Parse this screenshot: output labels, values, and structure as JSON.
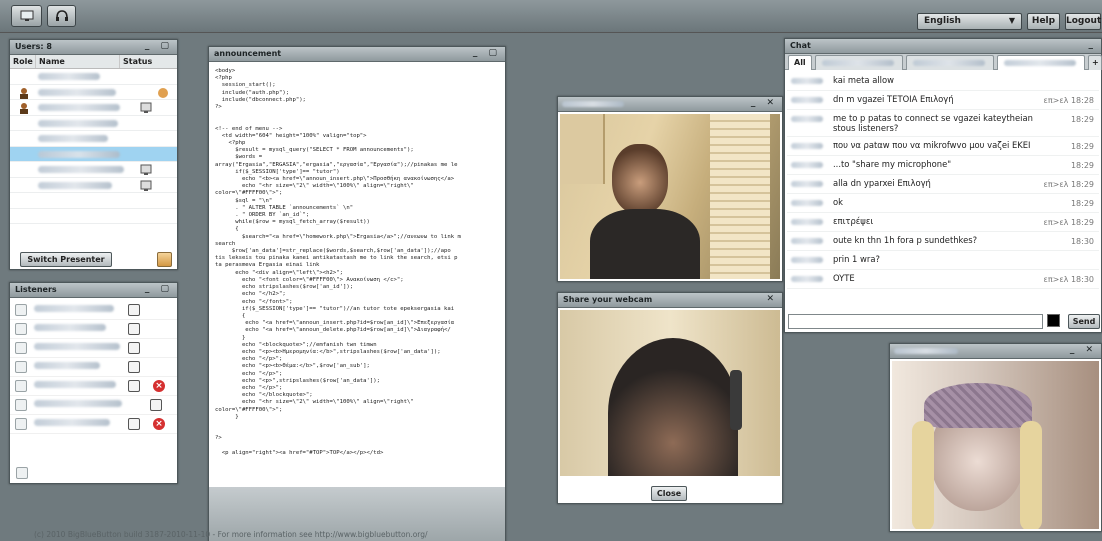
{
  "topbar": {
    "language": "English",
    "help": "Help",
    "logout": "Logout"
  },
  "users": {
    "title": "Users: 8",
    "col_role": "Role",
    "col_name": "Name",
    "col_status": "Status",
    "switch_presenter": "Switch Presenter"
  },
  "listeners": {
    "title": "Listeners"
  },
  "announcement": {
    "title": "announcement",
    "code": "<body>\n<?php\n  session_start();\n  include(\"auth.php\");\n  include(\"dbconnect.php\");\n?>\n\n\n<!-- end of menu -->\n  <td width=\"604\" height=\"100%\" valign=\"top\">\n    <?php\n      $result = mysql_query(\"SELECT * FROM announcements\");\n      $words =\narray(\"Ergasia\",\"ERGASIA\",\"ergasia\",\"εργασία\",\"Εργασία\");//pinakas me le\n      if($_SESSION['type']== \"tutor\")\n        echo \"<b><a href=\\\"announ_insert.php\\\">Προσθήκη ανακοίνωσης</a>\n        echo \"<hr size=\\\"2\\\" width=\\\"100%\\\" align=\\\"right\\\"\ncolor=\\\"#FFFF00\\\">\";\n      $sql = \"\\n\"\n      . \" ALTER TABLE `announcements` \\n\"\n      . \" ORDER BY `an_id`\";\n      while($row = mysql_fetch_array($result))\n      {\n        $search=\"<a href=\\\"homework.php\\\">Ergasia</a>\";//ανεωνω to link m\nsearch\n     $row['an_data']=str_replace($words,$search,$row['an_data']);//apo\ntis lekseis tou pinaka kanei antikatastash me to link the search, etsi p\nta perasmeva Ergasia einai link\n      echo \"<div align=\\\"left\\\"><h2>\";\n        echo \"<font color=\\\"#FFFF00\\\"> Ανακοίνωση </c>\";\n        echo stripslashes($row['an_id']);\n        echo \"</h2>\";\n        echo \"</font>\";\n        if($_SESSION['type']== \"tutor\")//an tutor tote epeksergasia kai\n        {\n         echo \"<a href=\\\"announ_insert.php?id=$row[an_id]\\\">Επεξεργασία\n         echo \"<a href=\\\"announ_delete.php?id=$row[an_id]\\\">Διαγραφή</\n        }\n        echo \"<blockquote>\";//emfanish twn timwn\n        echo \"<p><b>Ημερομηνία:</b>\",stripslashes($row['an_data']);\n        echo \"</p>\";\n        echo \"<p><b>Θέμα:</b>\",$row['an_sub'];\n        echo \"</p>\";\n        echo \"<p>\",stripslashes($row['an_data']);\n        echo \"</p>\";\n        echo \"</blockquote>\";\n        echo \"<hr size=\\\"2\\\" width=\\\"100%\\\" align=\\\"right\\\"\ncolor=\\\"#FFFF00\\\">\";\n      }\n\n\n?>\n\n  <p align=\"right\"><a href=\"#TOP\">TOP</a></p></td>"
  },
  "webcam_share": {
    "title": "Share your webcam",
    "close": "Close"
  },
  "chat": {
    "title": "Chat",
    "tab_all": "All",
    "tab_plus": "+",
    "send": "Send",
    "messages": [
      {
        "text": "kai meta allow",
        "time": ""
      },
      {
        "text": "dn m vgazei TETOIA Επιλογή",
        "time": "επ>ελ 18:28"
      },
      {
        "text": "me to p patas to connect se vgazei kateytheian stous listeners?",
        "time": "18:29"
      },
      {
        "text": "που να ρatαw που vα mikrofwvo μου vaζei EKEI",
        "time": "18:29"
      },
      {
        "text": "...to \"share my microphone\"",
        "time": "18:29"
      },
      {
        "text": "alla dn yparxei Επιλογή",
        "time": "επ>ελ 18:29"
      },
      {
        "text": "ok",
        "time": "18:29"
      },
      {
        "text": "επιτρέψει",
        "time": "επ>ελ 18:29"
      },
      {
        "text": "oute kn thn 1h fora p sundethkes?",
        "time": "18:30"
      },
      {
        "text": "prin 1 wra?",
        "time": ""
      },
      {
        "text": "OYTE",
        "time": "επ>ελ 18:30"
      }
    ]
  },
  "footer": {
    "text": "(c) 2010 BigBlueButton build 3187-2010-11-10 - For more information see http://www.bigbluebutton.org/"
  }
}
